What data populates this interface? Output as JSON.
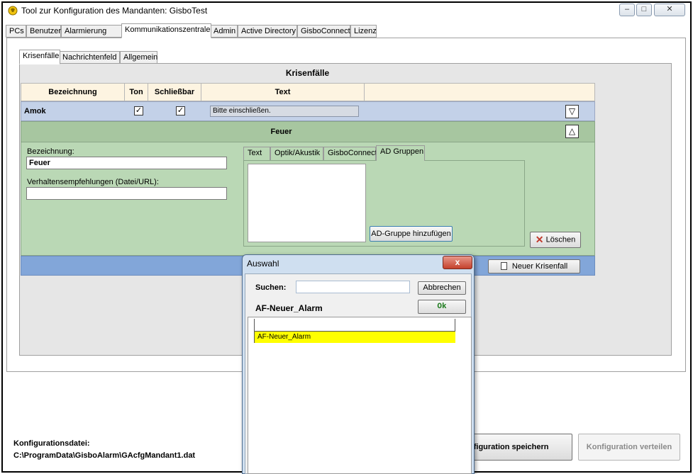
{
  "window": {
    "title": "Tool zur Konfiguration des Mandanten: GisboTest",
    "controls": {
      "minimize": "–",
      "maximize": "□",
      "close": "✕"
    }
  },
  "main_tabs": [
    {
      "label": "PCs"
    },
    {
      "label": "Benutzer"
    },
    {
      "label": "Alarmierung"
    },
    {
      "label": "Kommunikationszentrale"
    },
    {
      "label": "Admin"
    },
    {
      "label": "Active Directory"
    },
    {
      "label": "GisboConnect"
    },
    {
      "label": "Lizenz"
    }
  ],
  "sub_tabs": [
    {
      "label": "Krisenfälle"
    },
    {
      "label": "Nachrichtenfeld"
    },
    {
      "label": "Allgemein"
    }
  ],
  "crisis": {
    "title": "Krisenfälle",
    "columns": [
      "Bezeichnung",
      "Ton",
      "Schließbar",
      "Text"
    ],
    "rows": [
      {
        "name": "Amok",
        "ton": true,
        "schliessbar": true,
        "text": "Bitte einschließen.",
        "toggle": "▽"
      }
    ],
    "expanded": {
      "name": "Feuer",
      "toggle": "△",
      "bezeichnung_label": "Bezeichnung:",
      "bezeichnung_value": "Feuer",
      "verhalten_label": "Verhaltensempfehlungen (Datei/URL):",
      "verhalten_value": "",
      "detail_tabs": [
        "Text",
        "Optik/Akustik",
        "GisboConnect",
        "AD Gruppen"
      ],
      "add_group_button": "AD-Gruppe hinzufügen",
      "delete_button": "Löschen"
    },
    "new_button": "Neuer Krisenfall"
  },
  "footer": {
    "config_label": "Konfigurationsdatei:",
    "config_path": "C:\\ProgramData\\GisboAlarm\\GAcfgMandant1.dat",
    "save_button": "nfiguration speichern",
    "distribute_button": "Konfiguration verteilen"
  },
  "dialog": {
    "title": "Auswahl",
    "search_label": "Suchen:",
    "search_value": "",
    "cancel_button": "Abbrechen",
    "ok_button": "Ok",
    "selected_name": "AF-Neuer_Alarm",
    "list_items": [
      "AF-Neuer_Alarm"
    ],
    "close": "x"
  }
}
